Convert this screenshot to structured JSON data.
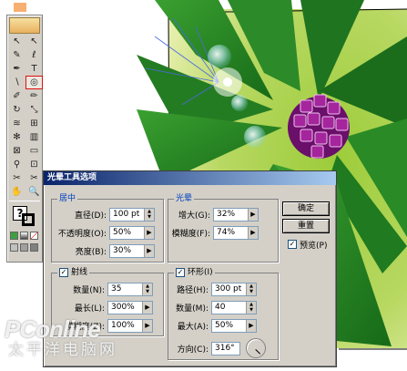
{
  "toolbox": {
    "tools": [
      {
        "name": "selection-tool",
        "glyph": "↖"
      },
      {
        "name": "direct-selection-tool",
        "glyph": "↖"
      },
      {
        "name": "magic-wand-tool",
        "glyph": "✎"
      },
      {
        "name": "lasso-tool",
        "glyph": "ℓ"
      },
      {
        "name": "pen-tool",
        "glyph": "✒"
      },
      {
        "name": "type-tool",
        "glyph": "T"
      },
      {
        "name": "line-tool",
        "glyph": "∖"
      },
      {
        "name": "flare-tool",
        "glyph": "◎",
        "active": true
      },
      {
        "name": "paintbrush-tool",
        "glyph": "✐"
      },
      {
        "name": "pencil-tool",
        "glyph": "✏"
      },
      {
        "name": "rotate-tool",
        "glyph": "↻"
      },
      {
        "name": "scale-tool",
        "glyph": "⤡"
      },
      {
        "name": "warp-tool",
        "glyph": "≋"
      },
      {
        "name": "free-transform-tool",
        "glyph": "⊞"
      },
      {
        "name": "symbol-sprayer-tool",
        "glyph": "✻"
      },
      {
        "name": "column-graph-tool",
        "glyph": "▥"
      },
      {
        "name": "mesh-tool",
        "glyph": "⊠"
      },
      {
        "name": "gradient-tool",
        "glyph": "▭"
      },
      {
        "name": "eyedropper-tool",
        "glyph": "⚲"
      },
      {
        "name": "blend-tool",
        "glyph": "⊡"
      },
      {
        "name": "slice-tool",
        "glyph": "✂"
      },
      {
        "name": "scissors-tool",
        "glyph": "✂"
      },
      {
        "name": "hand-tool",
        "glyph": "✋"
      },
      {
        "name": "zoom-tool",
        "glyph": "🔍"
      }
    ],
    "fill_glyph": "?"
  },
  "dialog": {
    "title": "光晕工具选项",
    "center": {
      "legend": "居中",
      "diameter": {
        "label": "直径(D):",
        "value": "100 pt"
      },
      "opacity": {
        "label": "不透明度(O):",
        "value": "50%"
      },
      "brightness": {
        "label": "亮度(B):",
        "value": "30%"
      }
    },
    "halo": {
      "legend": "光晕",
      "growth": {
        "label": "增大(G):",
        "value": "32%"
      },
      "fuzziness": {
        "label": "模糊度(F):",
        "value": "74%"
      }
    },
    "rays": {
      "legend": "射线",
      "number": {
        "label": "数量(N):",
        "value": "35"
      },
      "longest": {
        "label": "最长(L):",
        "value": "300%"
      },
      "fuzziness": {
        "label": "模糊度(Z):",
        "value": "100%"
      }
    },
    "rings": {
      "legend": "环形(I)",
      "path": {
        "label": "路径(H):",
        "value": "300 pt"
      },
      "number": {
        "label": "数量(M):",
        "value": "40"
      },
      "largest": {
        "label": "最大(A):",
        "value": "50%"
      },
      "direction": {
        "label": "方向(C):",
        "value": "316°"
      }
    },
    "buttons": {
      "ok": "确定",
      "reset": "重置"
    },
    "preview": {
      "label": "预览(P)",
      "checked": true
    }
  },
  "watermark": {
    "logo": "PConline",
    "cn": "太平洋电脑网"
  },
  "colors": {
    "leaf": "#2e8b2a",
    "flower": "#8a1a8a",
    "title_start": "#0a246a",
    "title_end": "#a6caf0"
  }
}
